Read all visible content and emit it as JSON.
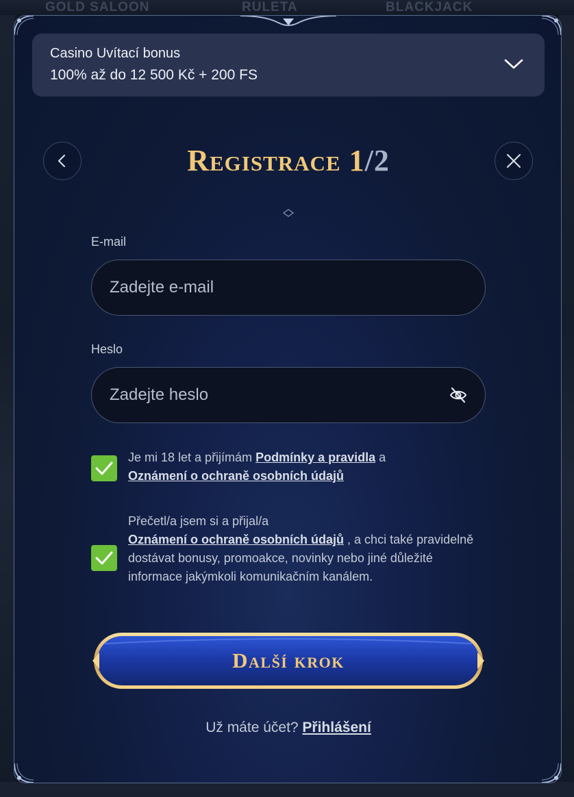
{
  "background": {
    "games": [
      "GOLD SALOON",
      "RULETA",
      "BLACKJACK"
    ]
  },
  "bonus": {
    "title": "Casino Uvítací bonus",
    "amount": "100% až do 12 500 Kč + 200 FS",
    "icon": "chevron-down-icon"
  },
  "header": {
    "title_main": "Registrace",
    "title_step": "1",
    "title_slash": "/",
    "title_total": "2",
    "back_icon": "chevron-left-icon",
    "close_icon": "close-icon"
  },
  "form": {
    "email_label": "E-mail",
    "email_placeholder": "Zadejte e-mail",
    "password_label": "Heslo",
    "password_placeholder": "Zadejte heslo",
    "password_icon": "eye-off-icon"
  },
  "consents": {
    "age": {
      "checked": true,
      "text_before": "Je mi 18 let a přijímám ",
      "link_terms": "Podmínky a pravidla",
      "text_middle": " a",
      "link_privacy": "Oznámení o ochraně osobních údajů"
    },
    "marketing": {
      "checked": true,
      "text_before": "Přečetl/a jsem si a přijal/a",
      "link_privacy": "Oznámení o ochraně osobních údajů",
      "text_after": " , a chci také pravidelně dostávat bonusy, promoakce, novinky nebo jiné důležité informace jakýmkoli komunikačním kanálem."
    }
  },
  "actions": {
    "next_label": "Další krok",
    "login_prompt": "Už máte účet? ",
    "login_link": "Přihlášení"
  },
  "colors": {
    "gold": "#f1c878",
    "check_green": "#6cc03a",
    "button_blue": "#1c3aa8"
  }
}
